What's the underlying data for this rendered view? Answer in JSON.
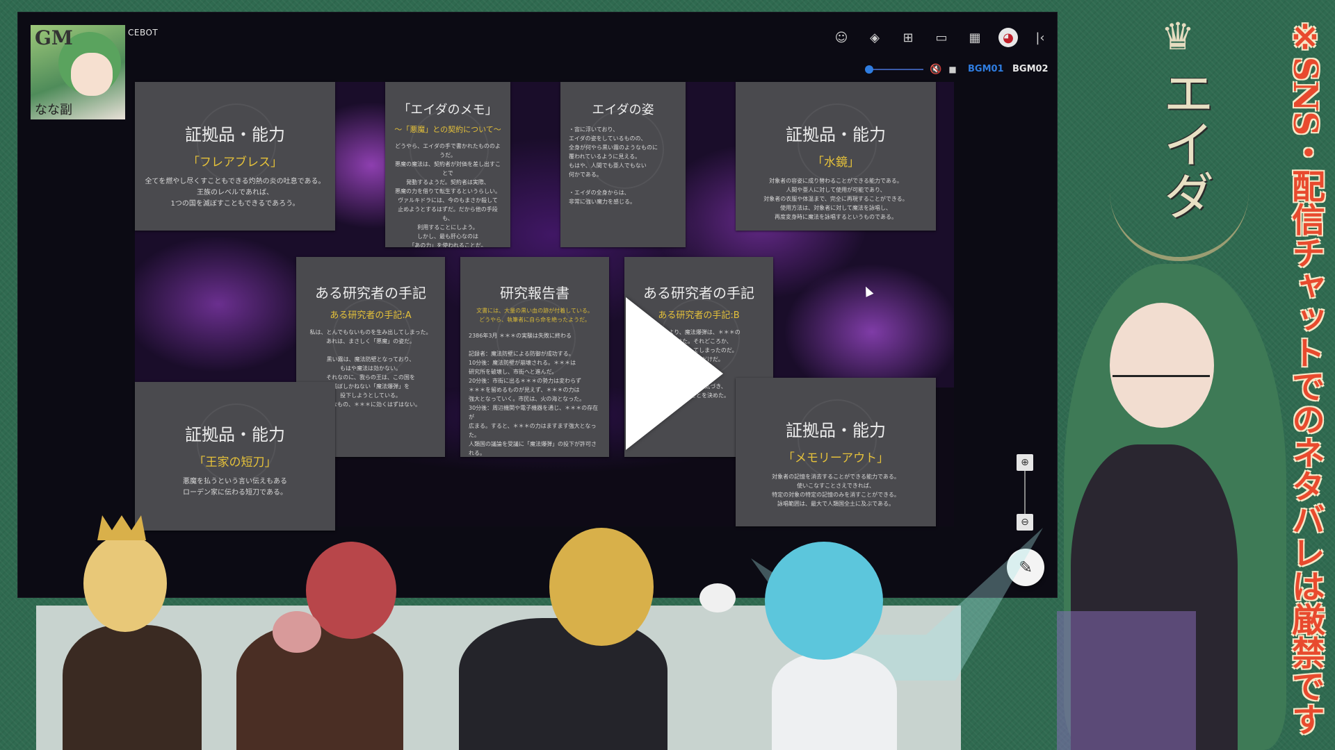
{
  "app": {
    "title": "CEBOT",
    "avatar_text_gm": "GM",
    "avatar_signature": "なな副",
    "toolbar_icons": [
      "face-icon",
      "layers-icon",
      "add-note-icon",
      "screen-icon",
      "scene-icon",
      "avatar-icon",
      "collapse-icon"
    ],
    "bgm": {
      "labels": [
        "BGM01",
        "BGM02"
      ],
      "active_color": "#2f7de0",
      "inactive_color": "#e6e6e6"
    }
  },
  "cards": [
    {
      "title": "証拠品・能力",
      "subtitle": "「フレアブレス」",
      "body": "全てを燃やし尽くすこともできる灼熱の炎の吐息である。\n王族のレベルであれば、\n1つの国を滅ぼすこともできるであろう。"
    },
    {
      "title": "「エイダのメモ」",
      "subtitle": "〜「悪魔」との契約について〜",
      "body": "どうやら、エイダの手で書かれたもののようだ。\n悪魔の魔法は、契約者が対価を差し出すことで\n発動するようだ。契約者は実際、\n悪魔の力を借りて転生するというらしい。\nヴァルキドラには、今のもまさか殺して\n止めようとするはずだ。だから他の手段も、\n利用することにしよう。\nしかし、最も肝心なのは\n「あの力」を使われることだ。\nあぁ、今のままであれば目的はかなうだろう。"
    },
    {
      "title": "エイダの姿",
      "body": "・宙に浮いており、\nエイダの姿をしているものの、\n全身が何やら黒い霧のようなものに\n覆われているように見える。\nもはや、人間でも亜人でもない\n何かである。\n\n・エイダの全身からは、\n非常に強い魔力を感じる。"
    },
    {
      "title": "証拠品・能力",
      "subtitle": "「水鏡」",
      "body": "対象者の容姿に成り替わることができる能力である。\n人間や亜人に対して使用が可能であり、\n対象者の衣服や体温まで、完全に再現することができる。\n使用方法は、対象者に対して魔法を詠唱し、\n再度変身時に魔法を詠唱するというものである。"
    },
    {
      "title": "ある研究者の手記",
      "subtitle": "ある研究者の手記:A",
      "body": "私は、とんでもないものを生み出してしまった。\nあれは、まさしく「悪魔」の姿だ。\n\n黒い霧は、魔法防壁となっており、\nもはや魔法は効かない。\nそれなのに、我らの王は、この国を\n滅ぼしかねない「魔法爆弾」を\n投下しようとしている。\nそんなもの、＊＊＊に効くはずはない。"
    },
    {
      "title": "研究報告書",
      "subtitle": "文書には、大量の黒い血の跡が付着している。\nどうやら、執筆者に自ら命を絶ったようだ。",
      "body": "2386年3月 ＊＊＊の実験は失敗に終わる\n\n記録者：魔法防壁による防御が成功する。\n10分後：魔法防壁が崩壊される。＊＊＊は\n研究所を破壊し、市街へと進んだ。\n20分後：市街に出る＊＊＊の勢力は変わらず\n＊＊＊を留めるものが見えず、＊＊＊の力は\n強大となっていく。市民は、火の海となった。\n30分後：周辺機関や電子機器を通じ、＊＊＊の存在が\n広まる。すると、＊＊＊の力はますます強大となった。\n人類国の議論を受議に「魔法爆弾」の投下が許可される。"
    },
    {
      "title": "ある研究者の手記",
      "subtitle": "ある研究者の手記:B",
      "body": "…により、魔法爆弾は、＊＊＊の\n…抜けた。それどころか、\n…家を滅ぼしてしまったのだ。\n…ゃ私にはだけだ。\n…と思ったが、\n…っていった。\n…めることに気づき、\n…を施うことを決めた。"
    },
    {
      "title": "証拠品・能力",
      "subtitle": "「王家の短刀」",
      "body": "悪魔を払うという言い伝えもある\nローデン家に伝わる短刀である。"
    },
    {
      "title": "証拠品・能力",
      "subtitle": "「メモリーアウト」",
      "body": "対象者の記憶を消去することができる能力である。\n使いこなすことさえできれば、\n特定の対象の特定の記憶のみを消すことができる。\n詠唱範囲は、最大で人類国全土に及ぶである。"
    }
  ],
  "overlay": {
    "play_icon": "play-icon",
    "zoom_in_icon": "zoom-in-icon",
    "zoom_out_icon": "zoom-out-icon",
    "edit_icon": "pencil-icon"
  },
  "stream": {
    "character_name": "エイダ",
    "warning": "※SNS・配信チャットでのネタバレは厳禁です",
    "warning_color": "#e84a2e",
    "background_color": "#2f6a50"
  }
}
